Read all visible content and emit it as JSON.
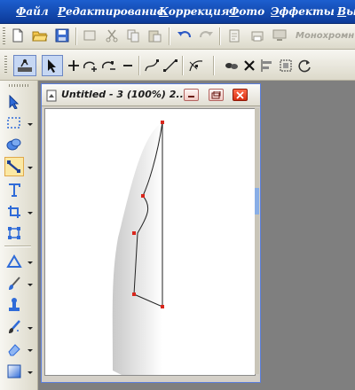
{
  "menu": {
    "items": [
      {
        "acc": "Ф",
        "rest": "айл"
      },
      {
        "acc": "Р",
        "rest": "едактирование"
      },
      {
        "acc": "К",
        "rest": "оррекция"
      },
      {
        "acc": "Ф",
        "rest": "ото"
      },
      {
        "acc": "Э",
        "rest": "ффекты"
      },
      {
        "acc": "В",
        "rest": "ы"
      }
    ]
  },
  "toolbar": {
    "mono_label": "Монохромн"
  },
  "document": {
    "title": "Untitled - 3 (100%) 2..."
  },
  "colors": {
    "menubar": "#0c3a98",
    "path_stroke": "#222222",
    "node_color": "#d9261c",
    "active_tool": "#fbe8a3"
  },
  "icons": {
    "toolbar1": [
      "new-document-icon",
      "open-folder-icon",
      "save-icon",
      "crop-icon",
      "cut-icon",
      "copy-icon",
      "paste-icon",
      "undo-icon",
      "redo-icon",
      "clipboard-icon",
      "print-icon",
      "monitor-icon"
    ],
    "toolbar2": [
      "path-edit-icon",
      "pointer-icon",
      "add-node-icon",
      "lasso-add-icon",
      "lasso-subtract-icon",
      "minus-icon",
      "curve-node-icon",
      "line-node-icon",
      "smooth-node-icon",
      "link-icon",
      "delete-icon",
      "align-left-icon",
      "marquee-icon",
      "refresh-icon"
    ],
    "palette": [
      "pick-tool-icon",
      "marquee-tool-icon",
      "blob-tool-icon",
      "node-edit-tool-icon",
      "text-tool-icon",
      "crop-tool-icon",
      "transform-tool-icon",
      "shape-tool-icon",
      "paint-tool-icon",
      "clone-tool-icon",
      "brush-tool-icon",
      "eraser-tool-icon",
      "gradient-tool-icon"
    ]
  }
}
